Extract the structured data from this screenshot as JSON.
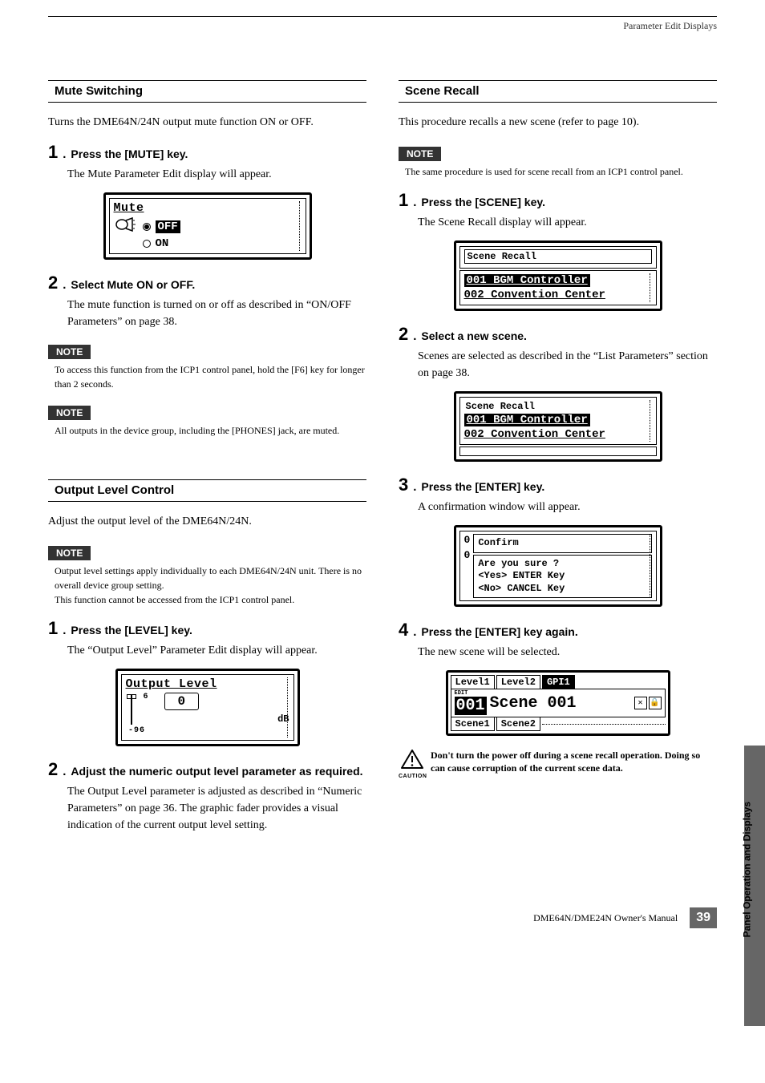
{
  "running_head": "Parameter Edit Displays",
  "side_tab": "Panel Operation and Displays",
  "footer": {
    "manual": "DME64N/DME24N Owner's Manual",
    "page": "39"
  },
  "note_label": "NOTE",
  "caution_label": "CAUTION",
  "left": {
    "mute": {
      "heading": "Mute Switching",
      "intro": "Turns the DME64N/24N output mute function ON or OFF.",
      "step1": {
        "num": "1",
        "title": "Press the [MUTE] key.",
        "body": "The Mute Parameter Edit display will appear."
      },
      "lcd": {
        "title": "Mute",
        "off": "OFF",
        "on": "ON"
      },
      "step2": {
        "num": "2",
        "title": "Select Mute ON or OFF.",
        "body": "The mute function is turned on or off as described in “ON/OFF Parameters” on page 38."
      },
      "note1": "To access this function from the ICP1 control panel, hold the [F6] key for longer than 2 seconds.",
      "note2": "All outputs in the device group, including the [PHONES] jack, are muted."
    },
    "output": {
      "heading": "Output Level Control",
      "intro": "Adjust the output level of the DME64N/24N.",
      "note1": "Output level settings apply individually to each DME64N/24N unit. There is no overall device group setting.\nThis function cannot be accessed from the ICP1 control panel.",
      "step1": {
        "num": "1",
        "title": "Press the [LEVEL] key.",
        "body": "The “Output Level” Parameter Edit display will appear."
      },
      "lcd": {
        "title": "Output Level",
        "top": "6",
        "bottom": "-96",
        "value": "0",
        "unit": "dB"
      },
      "step2": {
        "num": "2",
        "title": "Adjust the numeric output level parameter as required.",
        "body": "The Output Level parameter is adjusted as described in “Numeric Parameters” on page 36. The graphic fader provides a visual indication of the current output level setting."
      }
    }
  },
  "right": {
    "scene": {
      "heading": "Scene Recall",
      "intro": "This procedure recalls a new scene (refer to page 10).",
      "note1": "The same procedure is used for scene recall from an ICP1 control panel.",
      "step1": {
        "num": "1",
        "title": "Press the [SCENE] key.",
        "body": "The Scene Recall display will appear."
      },
      "lcd1": {
        "title": "Scene Recall",
        "row1": "001 BGM_Controller",
        "row2": "002 Convention_Center"
      },
      "step2": {
        "num": "2",
        "title": "Select a new scene.",
        "body": "Scenes are selected as described in the “List Parameters” section on page 38."
      },
      "step3": {
        "num": "3",
        "title": "Press the [ENTER] key.",
        "body": "A confirmation window will appear."
      },
      "confirm": {
        "title": "Confirm",
        "line1": "Are you sure ?",
        "line2": "<Yes> ENTER Key",
        "line3": "<No>  CANCEL Key"
      },
      "step4": {
        "num": "4",
        "title": "Press the [ENTER] key again.",
        "body": "The new scene will be selected."
      },
      "panel": {
        "tabs": [
          "Level1",
          "Level2",
          "GPI1"
        ],
        "edit": "EDIT",
        "scene_num": "001",
        "scene_name": "Scene 001",
        "bottom": [
          "Scene1",
          "Scene2"
        ]
      },
      "caution": "Don't turn the power off during a scene recall operation. Doing so can cause corruption of the current scene data."
    }
  }
}
